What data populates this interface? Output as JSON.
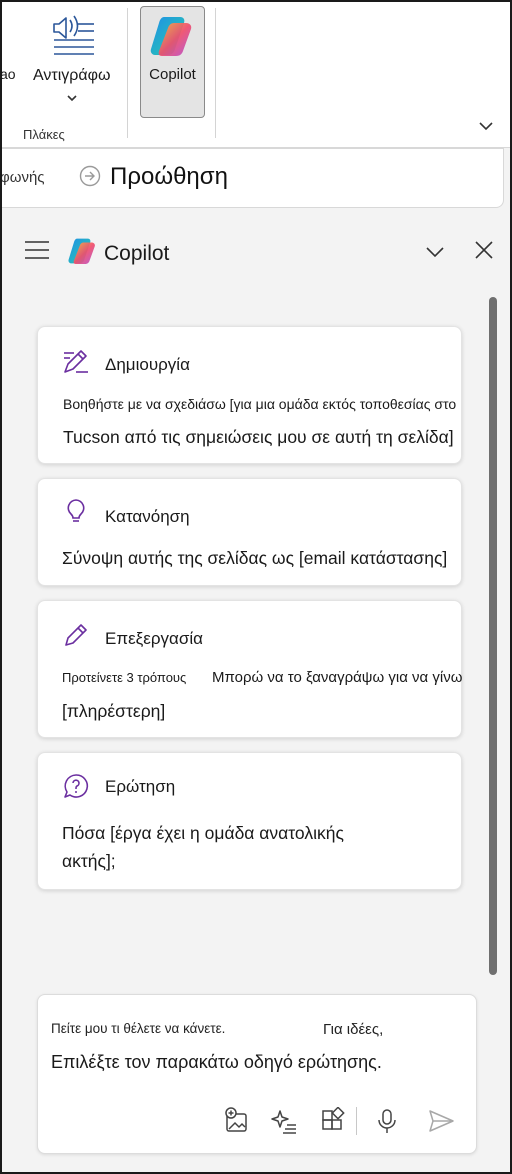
{
  "ribbon": {
    "partial_button_label": "ao",
    "dictate_label": "Αντιγράφω",
    "group_label": "Πλάκες",
    "copilot_label": "Copilot"
  },
  "subbar": {
    "partial_label": "φωνής",
    "forward_label": "Προώθηση"
  },
  "pane": {
    "title": "Copilot",
    "cards": [
      {
        "title": "Δημιουργία",
        "icon": "compose-icon",
        "line1": "Βοηθήστε με να σχεδιάσω [για μια ομάδα εκτός τοποθεσίας στο",
        "line2": "Tucson από τις σημειώσεις μου σε αυτή τη σελίδα]"
      },
      {
        "title": "Κατανόηση",
        "icon": "lightbulb-icon",
        "line1": "Σύνοψη αυτής της σελίδας ως [email κατάστασης]"
      },
      {
        "title": "Επεξεργασία",
        "icon": "pencil-icon",
        "line1a": "Προτείνετε 3 τρόπους",
        "line1b": "Μπορώ να το ξαναγράψω για να γίνω",
        "line2": "[πληρέστερη]"
      },
      {
        "title": "Ερώτηση",
        "icon": "question-bubble-icon",
        "line1": "Πόσα [έργα έχει η ομάδα ανατολικής",
        "line2": "ακτής];"
      }
    ],
    "input": {
      "placeholder_part1": "Πείτε μου τι θέλετε να κάνετε.",
      "placeholder_part2": "Για ιδέες,",
      "placeholder_line2": "Επιλέξτε τον παρακάτω οδηγό ερώτησης."
    }
  },
  "colors": {
    "accent_purple": "#6b2fa0",
    "scrollbar": "#6f6f6f",
    "copilot_button_bg": "#e4e4e4"
  }
}
